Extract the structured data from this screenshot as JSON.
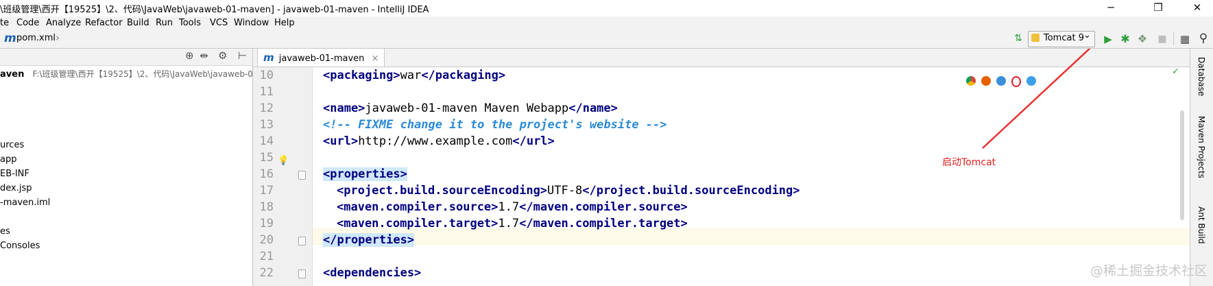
{
  "window": {
    "title": "\\班级管理\\西开【19525】\\2、代码\\JavaWeb\\javaweb-01-maven] - javaweb-01-maven - IntelliJ IDEA",
    "minimize_glyph": "─",
    "maximize_glyph": "❐",
    "close_glyph": "✕"
  },
  "menu": [
    "te",
    "Code",
    "Analyze",
    "Refactor",
    "Build",
    "Run",
    "Tools",
    "VCS",
    "Window",
    "Help"
  ],
  "navbar": {
    "logo_glyph": "m",
    "file": "pom.xml",
    "arrow": "›"
  },
  "toolbar": {
    "run_config": "Tomcat 9",
    "dropdown_glyph": "⌄",
    "run_glyph": "▶",
    "debug_glyph": "✱",
    "coverage_glyph": "❖",
    "stop_glyph": "■",
    "structure_glyph": "▦",
    "search_glyph": "⚲",
    "sort_glyph": "⇅"
  },
  "project": {
    "toolbar_icons": [
      "⊕",
      "⇹",
      "⚙",
      "⊢"
    ],
    "root_name": "aven",
    "root_path": "F:\\班级管理\\西开【19525】\\2、代码\\JavaWeb\\javaweb-01-n",
    "items": [
      "urces",
      "app",
      "EB-INF",
      "dex.jsp",
      "-maven.iml",
      "es",
      "Consoles"
    ]
  },
  "editor": {
    "tab_logo": "m",
    "tab_label": "javaweb-01-maven",
    "tab_close": "×",
    "line_numbers": [
      "10",
      "11",
      "12",
      "13",
      "14",
      "15",
      "16",
      "17",
      "18",
      "19",
      "20",
      "21",
      "22"
    ],
    "lines": {
      "l10": {
        "open": "<packaging>",
        "text": "war",
        "close": "</packaging>"
      },
      "l12": {
        "open": "<name>",
        "text": "javaweb-01-maven Maven Webapp",
        "close": "</name>"
      },
      "l13": {
        "comment": "<!-- FIXME change it to the project's website -->"
      },
      "l14": {
        "open": "<url>",
        "text": "http://www.example.com",
        "close": "</url>"
      },
      "l16": {
        "open": "<properties>"
      },
      "l17": {
        "open": "<project.build.sourceEncoding>",
        "text": "UTF-8",
        "close": "</project.build.sourceEncoding>"
      },
      "l18": {
        "open": "<maven.compiler.source>",
        "text": "1.7",
        "close": "</maven.compiler.source>"
      },
      "l19": {
        "open": "<maven.compiler.target>",
        "text": "1.7",
        "close": "</maven.compiler.target>"
      },
      "l20": {
        "close": "</properties>"
      },
      "l22": {
        "open": "<dependencies>"
      }
    },
    "bulb_glyph": "💡",
    "check_glyph": "✓"
  },
  "right_tools": [
    "Database",
    "Maven Projects",
    "Ant Build"
  ],
  "annotation": "启动Tomcat",
  "watermark": "@稀土掘金技术社区",
  "colors": {
    "run": "#2e9e3a",
    "arrow": "#e83030",
    "tag": "#000080",
    "comment": "#2b8ad6"
  }
}
